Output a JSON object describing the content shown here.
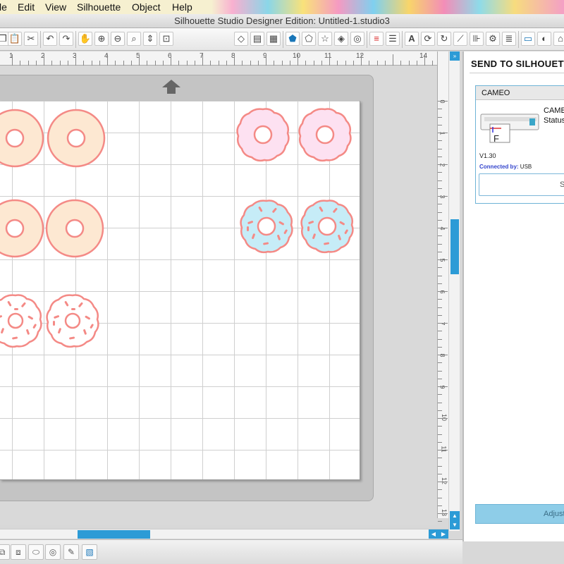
{
  "menu": {
    "items": [
      "le",
      "Edit",
      "View",
      "Silhouette",
      "Object",
      "Help"
    ]
  },
  "window": {
    "title": "Silhouette Studio Designer Edition: Untitled-1.studio3"
  },
  "toolbar": {
    "left_icons": [
      "copy-icon",
      "paste-icon",
      "cut-icon",
      "undo-icon",
      "redo-icon",
      "pan-icon",
      "zoom-in-icon",
      "zoom-out-icon",
      "zoom-select-icon",
      "drag-zoom-icon",
      "fit-to-page-icon"
    ],
    "right_icons": [
      "eraser-icon",
      "page-settings-icon",
      "grid-icon",
      "polygon-icon",
      "pentagon-icon",
      "star-icon",
      "rhombus-icon",
      "offset-icon",
      "line-color-icon",
      "line-style-icon",
      "text-icon",
      "rotate-icon",
      "replicate-icon",
      "knife-icon",
      "align-icon",
      "send-icon",
      "cut-settings-icon",
      "send-to-silhouette-icon"
    ],
    "text_tool_label": "A"
  },
  "ruler": {
    "horizontal": [
      "1",
      "2",
      "3",
      "4",
      "5",
      "6",
      "7",
      "8",
      "9",
      "10",
      "11",
      "12",
      "14"
    ],
    "vertical": [
      "0",
      "1",
      "2",
      "3",
      "4",
      "5",
      "6",
      "7",
      "8",
      "9",
      "10",
      "11",
      "12",
      "13"
    ]
  },
  "canvas": {
    "accent_color": "#f48a86",
    "cream_fill": "#fde8d2",
    "pink_fill": "#fde1f1",
    "blue_fill": "#c6ecf7",
    "scroll_color": "#2c9bd6"
  },
  "panel": {
    "title": "SEND TO SILHOUETTE",
    "device": {
      "header": "CAMEO",
      "name": "CAMEO",
      "status_label": "Status",
      "version": "V1.30",
      "connected_label": "Connected by:",
      "connected_value": "USB",
      "button_label": "S",
      "image_letter": "F"
    },
    "adjust_label": "Adjust"
  }
}
